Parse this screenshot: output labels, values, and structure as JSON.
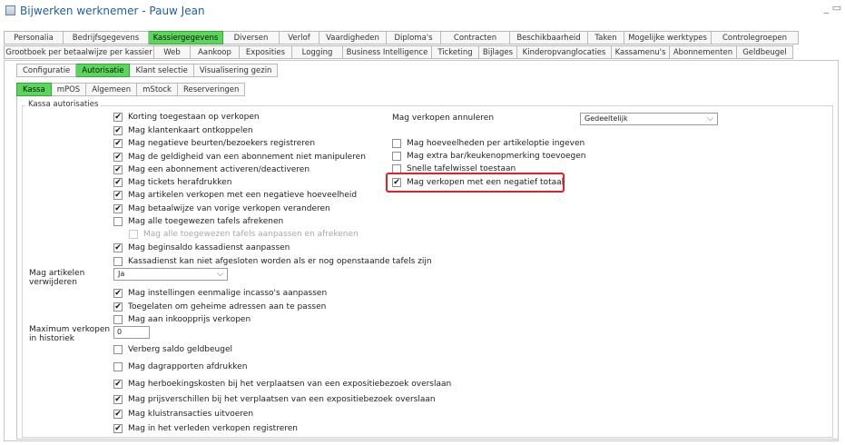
{
  "window": {
    "title": "Bijwerken werknemer - Pauw Jean",
    "controls": "_ ▭"
  },
  "tabs_row1": [
    "Personalia",
    "Bedrijfsgegevens",
    "Kassiergegevens",
    "Diversen",
    "Verlof",
    "Vaardigheden",
    "Diploma's",
    "Contracten",
    "Beschikbaarheid",
    "Taken",
    "Mogelijke werktypes",
    "Controlegroepen"
  ],
  "tabs_row2": [
    "Grootboek per betaalwijze per kassier",
    "Web",
    "Aankoop",
    "Exposities",
    "Logging",
    "Business Intelligence",
    "Ticketing",
    "Bijlages",
    "Kinderopvanglocaties",
    "Kassamenu's",
    "Abonnementen",
    "Geldbeugel"
  ],
  "tabs_row3": [
    "Configuratie",
    "Autorisatie",
    "Klant selectie",
    "Visualisering gezin"
  ],
  "tabs_row4": [
    "Kassa",
    "mPOS",
    "Algemeen",
    "mStock",
    "Reserveringen"
  ],
  "group_title": "Kassa autorisaties",
  "checks_left": [
    {
      "label": "Korting toegestaan op verkopen",
      "checked": true
    },
    {
      "label": "Mag klantenkaart ontkoppelen",
      "checked": true
    },
    {
      "label": "Mag negatieve beurten/bezoekers registreren",
      "checked": true
    },
    {
      "label": "Mag de geldigheid van een abonnement niet manipuleren",
      "checked": true
    },
    {
      "label": "Mag een abonnement activeren/deactiveren",
      "checked": true
    },
    {
      "label": "Mag tickets herafdrukken",
      "checked": true
    },
    {
      "label": "Mag artikelen verkopen met een negatieve hoeveelheid",
      "checked": true
    },
    {
      "label": "Mag betaalwijze van vorige verkopen veranderen",
      "checked": true
    },
    {
      "label": "Mag alle toegewezen tafels afrekenen",
      "checked": false
    },
    {
      "label": "Mag alle toegewezen tafels aanpassen en afrekenen",
      "checked": false,
      "disabled": true
    },
    {
      "label": "Mag beginsaldo kassadienst aanpassen",
      "checked": true
    },
    {
      "label": "Kassadienst kan niet afgesloten worden als er nog openstaande tafels zijn",
      "checked": false
    }
  ],
  "mag_artikelen_label": "Mag artikelen verwijderen",
  "mag_artikelen_value": "Ja",
  "checks_mid": [
    {
      "label": "Mag instellingen eenmalige incasso's aanpassen",
      "checked": true
    },
    {
      "label": "Toegelaten om geheime adressen aan te passen",
      "checked": true
    },
    {
      "label": "Mag aan inkoopprijs verkopen",
      "checked": false
    }
  ],
  "max_verkopen_label": "Maximum verkopen in historiek",
  "max_verkopen_value": "0",
  "checks_bottom": [
    {
      "label": "Verberg saldo geldbeugel",
      "checked": false
    },
    {
      "label": "Mag dagrapporten afdrukken",
      "checked": false
    },
    {
      "label": "Mag herboekingskosten bij het verplaatsen van een expositiebezoek overslaan",
      "checked": true
    },
    {
      "label": "Mag prijsverschillen bij het verplaatsen van een expositiebezoek overslaan",
      "checked": true
    },
    {
      "label": "Mag kluistransacties uitvoeren",
      "checked": true
    },
    {
      "label": "Mag in het verleden verkopen registreren",
      "checked": true
    }
  ],
  "annuleren_label": "Mag verkopen annuleren",
  "annuleren_value": "Gedeeltelijk",
  "checks_right": [
    {
      "label": "Mag hoeveelheden per artikeloptie ingeven",
      "checked": false
    },
    {
      "label": "Mag extra bar/keukenopmerking toevoegen",
      "checked": false
    },
    {
      "label": "Snelle tafelwissel toestaan",
      "checked": false
    },
    {
      "label": "Mag verkopen met een negatief totaal",
      "checked": true
    }
  ],
  "checkmark": "✔",
  "colors": {
    "active_tab": "#5ad65a",
    "highlight": "#e0202a",
    "title": "#1f5fa8"
  }
}
